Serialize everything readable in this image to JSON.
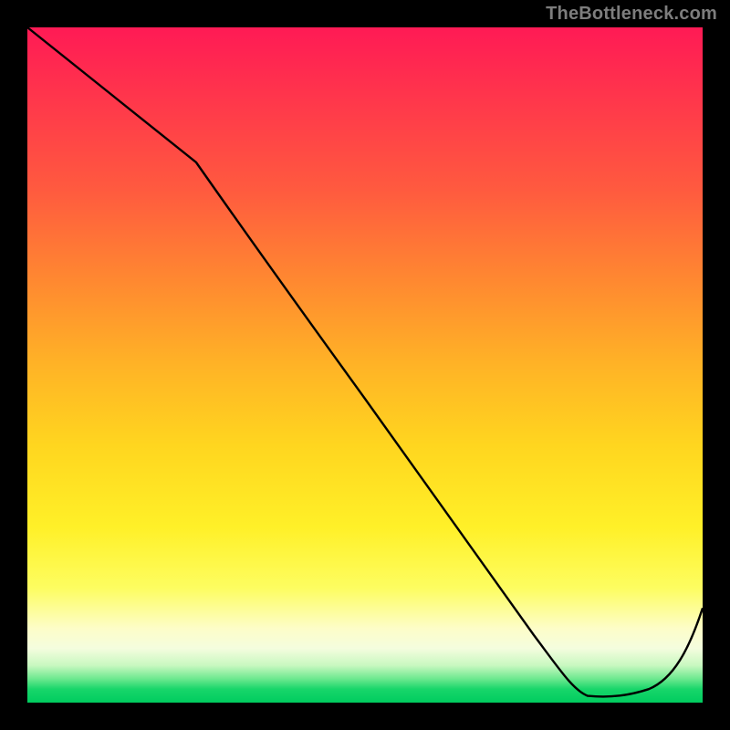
{
  "watermark": "TheBottleneck.com",
  "annotation": "",
  "chart_data": {
    "type": "line",
    "title": "",
    "xlabel": "",
    "ylabel": "",
    "ylim": [
      0,
      100
    ],
    "x": [
      0.0,
      0.25,
      0.5,
      0.75,
      0.83,
      0.92,
      1.0
    ],
    "values": [
      100,
      80,
      45,
      10,
      1,
      2,
      14
    ],
    "background_gradient": {
      "top_color": "#ff1a55",
      "mid_color": "#ffe028",
      "bottom_color": "#00cc5f"
    },
    "annotation_position_x": 0.83,
    "annotation_position_y": 0.02
  }
}
